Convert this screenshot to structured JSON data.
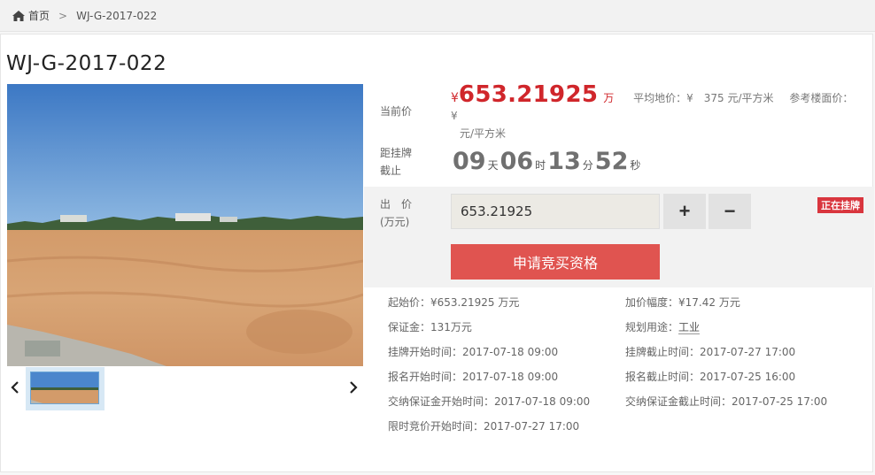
{
  "breadcrumb": {
    "home_label": "首页",
    "separator": ">",
    "current": "WJ-G-2017-022"
  },
  "title": "WJ-G-2017-022",
  "current_price": {
    "label": "当前价",
    "currency": "¥",
    "value": "653.21925",
    "unit": "万",
    "avg_land_label": "平均地价：",
    "avg_land_value": "¥　375 元/平方米",
    "floor_price_label": "参考楼面价：",
    "floor_price_value": "¥",
    "floor_price_unit": "元/平方米"
  },
  "countdown": {
    "label_line1": "距挂牌",
    "label_line2": "截止",
    "days": "09",
    "days_unit": "天",
    "hours": "06",
    "hours_unit": "时",
    "minutes": "13",
    "minutes_unit": "分",
    "seconds": "52",
    "seconds_unit": "秒"
  },
  "bid": {
    "label_line1": "出　价",
    "label_line2": "(万元)",
    "value": "653.21925",
    "plus_label": "+",
    "minus_label": "−",
    "status_badge": "正在挂牌",
    "apply_button": "申请竞买资格"
  },
  "details": {
    "start_price_label": "起始价：",
    "start_price": "¥653.21925 万元",
    "increment_label": "加价幅度：",
    "increment": "¥17.42 万元",
    "deposit_label": "保证金：",
    "deposit": "131万元",
    "usage_label": "规划用途：",
    "usage": "工业",
    "listing_start_label": "挂牌开始时间：",
    "listing_start": "2017-07-18 09:00",
    "listing_end_label": "挂牌截止时间：",
    "listing_end": "2017-07-27 17:00",
    "signup_start_label": "报名开始时间：",
    "signup_start": "2017-07-18 09:00",
    "signup_end_label": "报名截止时间：",
    "signup_end": "2017-07-25 16:00",
    "deposit_start_label": "交纳保证金开始时间：",
    "deposit_start": "2017-07-18 09:00",
    "deposit_end_label": "交纳保证金截止时间：",
    "deposit_end": "2017-07-25 17:00",
    "timed_bid_start_label": "限时竞价开始时间：",
    "timed_bid_start": "2017-07-27 17:00"
  },
  "colors": {
    "accent_red": "#d0262b",
    "button_red": "#e05450",
    "badge_red": "#d9363e"
  },
  "icons": {
    "home": "home-icon",
    "prev": "chevron-left-icon",
    "next": "chevron-right-icon"
  }
}
